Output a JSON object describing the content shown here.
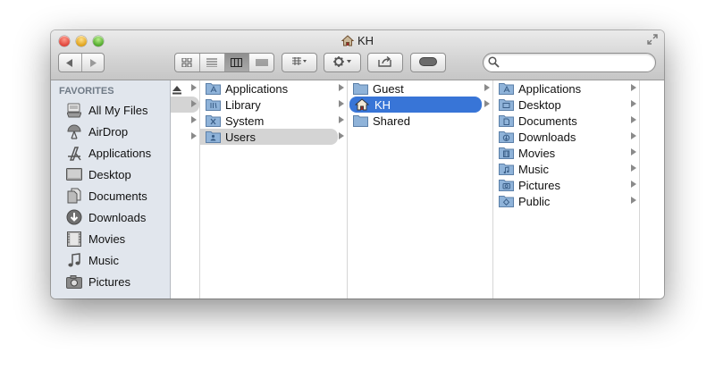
{
  "window": {
    "title": "KH"
  },
  "toolbar": {
    "back_icon": "back-arrow-icon",
    "forward_icon": "forward-arrow-icon",
    "view_modes": [
      "icon-view-icon",
      "list-view-icon",
      "column-view-icon",
      "coverflow-view-icon"
    ],
    "arrange_icon": "arrange-grid-icon",
    "action_icon": "gear-icon",
    "share_icon": "share-icon",
    "tag_icon": "toggle-pill-icon",
    "search": {
      "placeholder": "",
      "value": ""
    }
  },
  "sidebar": {
    "heading": "FAVORITES",
    "items": [
      {
        "label": "All My Files",
        "icon": "all-files-icon"
      },
      {
        "label": "AirDrop",
        "icon": "airdrop-icon"
      },
      {
        "label": "Applications",
        "icon": "applications-icon"
      },
      {
        "label": "Desktop",
        "icon": "desktop-icon"
      },
      {
        "label": "Documents",
        "icon": "documents-icon"
      },
      {
        "label": "Downloads",
        "icon": "downloads-icon"
      },
      {
        "label": "Movies",
        "icon": "movies-icon"
      },
      {
        "label": "Music",
        "icon": "music-icon"
      },
      {
        "label": "Pictures",
        "icon": "pictures-icon"
      }
    ]
  },
  "columns": {
    "col2": [
      {
        "label": "Applications"
      },
      {
        "label": "Library"
      },
      {
        "label": "System"
      },
      {
        "label": "Users"
      }
    ],
    "col3": [
      {
        "label": "Guest"
      },
      {
        "label": "KH"
      },
      {
        "label": "Shared"
      }
    ],
    "col4": [
      {
        "label": "Applications"
      },
      {
        "label": "Desktop"
      },
      {
        "label": "Documents"
      },
      {
        "label": "Downloads"
      },
      {
        "label": "Movies"
      },
      {
        "label": "Music"
      },
      {
        "label": "Pictures"
      },
      {
        "label": "Public"
      }
    ]
  },
  "colors": {
    "selection": "#3875d7",
    "sidebar_bg": "#e1e6ed",
    "folder": "#8fb3d9"
  }
}
